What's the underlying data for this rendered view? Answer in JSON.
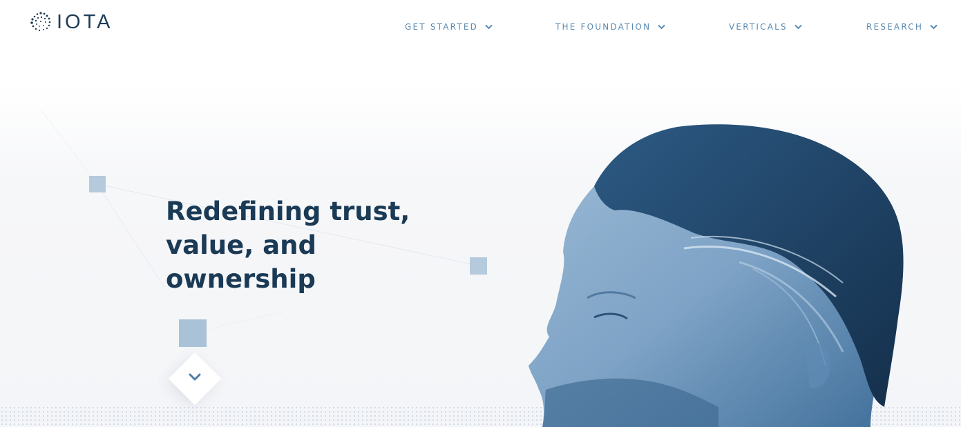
{
  "brand": {
    "name": "IOTA",
    "logo_icon": "iota-dots-logo-icon"
  },
  "nav": [
    {
      "label": "GET STARTED",
      "icon": "chevron-down-icon"
    },
    {
      "label": "THE FOUNDATION",
      "icon": "chevron-down-icon"
    },
    {
      "label": "VERTICALS",
      "icon": "chevron-down-icon"
    },
    {
      "label": "RESEARCH",
      "icon": "chevron-down-icon"
    }
  ],
  "hero": {
    "title_line1": "Redefining trust,",
    "title_line2": "value, and",
    "title_line3": "ownership"
  },
  "scroll_button": {
    "icon": "chevron-down-icon"
  },
  "colors": {
    "brand_dark": "#1a3a55",
    "nav_text": "#5a8ab0",
    "accent_square": "#a9c2d8",
    "portrait_blue": "#4f7fa8"
  }
}
